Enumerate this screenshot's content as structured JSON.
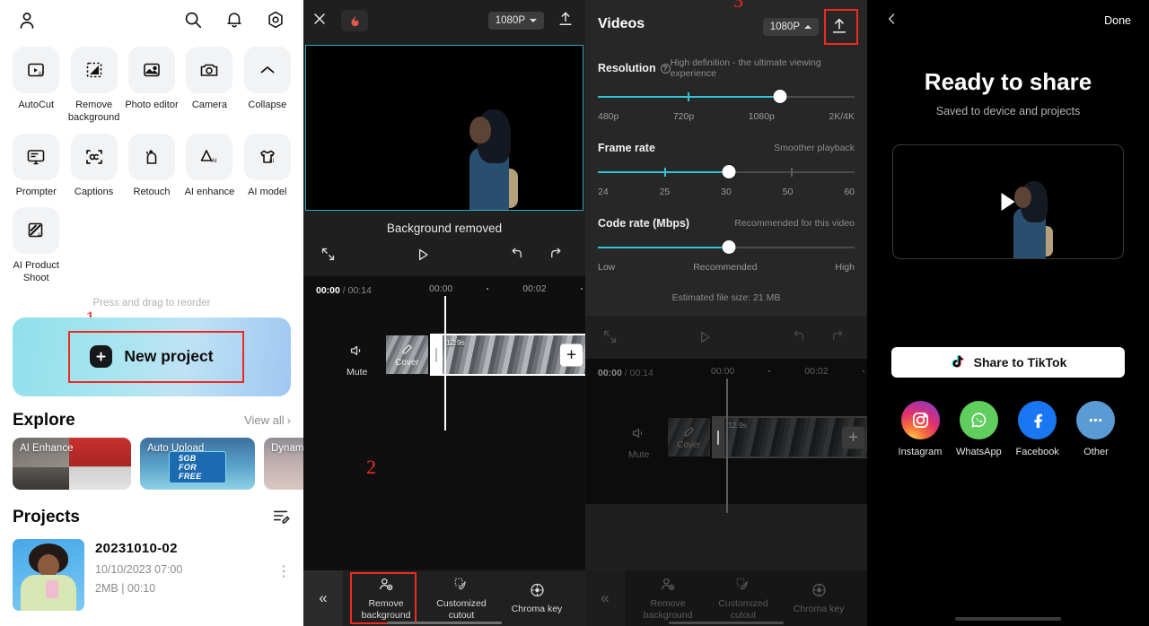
{
  "home": {
    "topbar": {
      "profile_icon": "person-icon",
      "search_icon": "search-icon",
      "bell_icon": "bell-icon",
      "settings_icon": "gear-icon"
    },
    "tools": [
      {
        "label": "AutoCut",
        "icon": "autocut-icon"
      },
      {
        "label": "Remove\nbackground",
        "icon": "remove-background-icon"
      },
      {
        "label": "Photo editor",
        "icon": "photo-editor-icon"
      },
      {
        "label": "Camera",
        "icon": "camera-icon"
      },
      {
        "label": "Collapse",
        "icon": "chevron-up-icon"
      },
      {
        "label": "Prompter",
        "icon": "prompter-icon"
      },
      {
        "label": "Captions",
        "icon": "captions-icon"
      },
      {
        "label": "Retouch",
        "icon": "retouch-icon"
      },
      {
        "label": "AI enhance",
        "icon": "ai-enhance-icon"
      },
      {
        "label": "AI model",
        "icon": "ai-model-icon"
      },
      {
        "label": "AI Product\nShoot",
        "icon": "ai-product-shoot-icon"
      }
    ],
    "reorder_hint": "Press and drag to reorder",
    "new_project_label": "New project",
    "step_1": "1",
    "explore": {
      "title": "Explore",
      "view_all": "View all",
      "cards": [
        {
          "label": "AI Enhance"
        },
        {
          "label": "Auto Upload",
          "badge": "5GB FOR FREE"
        },
        {
          "label": "Dynamic"
        }
      ]
    },
    "projects": {
      "title": "Projects",
      "items": [
        {
          "name": "20231010-02",
          "date": "10/10/2023 07:00",
          "size": "2MB",
          "duration": "00:10"
        }
      ]
    }
  },
  "editor": {
    "close_icon": "close-icon",
    "flame_icon": "flame-icon",
    "resolution_pill": "1080P",
    "export_icon": "upload-icon",
    "status_label": "Background removed",
    "controls": {
      "fullscreen_icon": "fullscreen-icon",
      "play_icon": "play-icon",
      "undo_icon": "undo-icon",
      "redo_icon": "redo-icon"
    },
    "timeline": {
      "current_time": "00:00",
      "total_time": "00:14",
      "ruler_marks": [
        "00:00",
        "00:02"
      ],
      "mute_label": "Mute",
      "cover_label": "Cover",
      "clip_duration": "12.9s",
      "add_label": "+"
    },
    "bottom_tools": [
      {
        "label": "Remove\nbackground",
        "icon": "remove-background-person-icon"
      },
      {
        "label": "Customized\ncutout",
        "icon": "customized-cutout-icon"
      },
      {
        "label": "Chroma key",
        "icon": "chroma-key-icon"
      }
    ],
    "collapse_icon": "chevron-double-left-icon",
    "step_2": "2"
  },
  "export": {
    "step_3": "3",
    "tab_label": "Videos",
    "resolution_pill": "1080P",
    "export_icon": "upload-icon",
    "settings": [
      {
        "name": "Resolution",
        "hint": "High definition - the ultimate viewing experience",
        "scale": [
          "480p",
          "720p",
          "1080p",
          "2K/4K"
        ],
        "value": "1080p",
        "fill_percent": 71,
        "knob_percent": 71,
        "tick_percent": 35
      },
      {
        "name": "Frame rate",
        "hint": "Smoother playback",
        "scale": [
          "24",
          "25",
          "30",
          "50",
          "60"
        ],
        "value": "30",
        "fill_percent": 51,
        "knob_percent": 51,
        "tick_percent": 26
      },
      {
        "name": "Code rate (Mbps)",
        "hint": "Recommended for this video",
        "scale": [
          "Low",
          "Recommended",
          "High"
        ],
        "value": "Recommended",
        "fill_percent": 51,
        "knob_percent": 51,
        "tick_percent": -1
      }
    ],
    "estimated_size": "Estimated file size: 21 MB",
    "help_glyph": "?"
  },
  "share": {
    "back_icon": "chevron-left-icon",
    "done_label": "Done",
    "title": "Ready to share",
    "subtitle": "Saved to device and projects",
    "play_icon": "play-icon",
    "tiktok_button": "Share to TikTok",
    "targets": [
      {
        "label": "Instagram",
        "icon": "instagram-icon",
        "color": "#e1306c"
      },
      {
        "label": "WhatsApp",
        "icon": "whatsapp-icon",
        "color": "#5fce5d"
      },
      {
        "label": "Facebook",
        "icon": "facebook-icon",
        "color": "#1977f3"
      },
      {
        "label": "Other",
        "icon": "more-horizontal-icon",
        "color": "#5b9bd5"
      }
    ]
  },
  "colors": {
    "accent_cyan": "#35c3d8",
    "highlight_red": "#ef2b21",
    "dark_bg": "#1f1f1f",
    "sheet_bg": "#272727"
  }
}
